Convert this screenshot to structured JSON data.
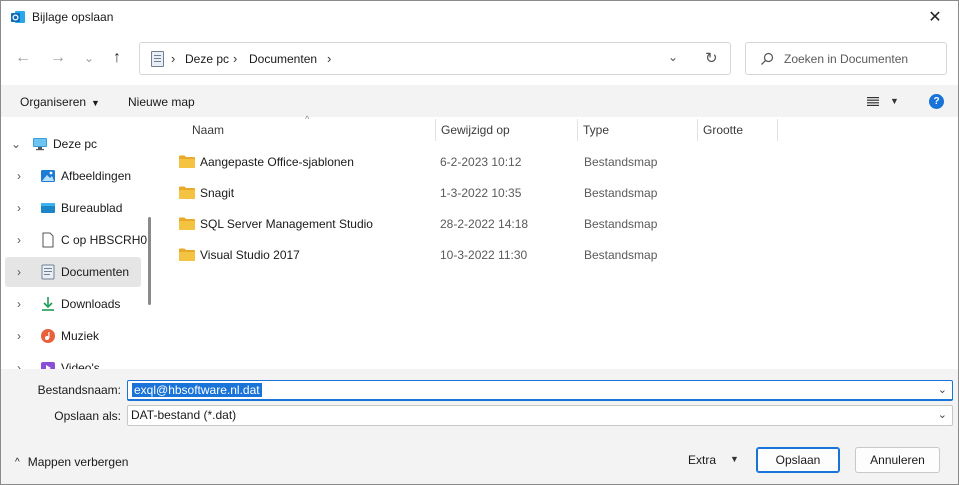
{
  "window": {
    "title": "Bijlage opslaan",
    "close_glyph": "✕"
  },
  "nav": {
    "back_glyph": "←",
    "forward_glyph": "→",
    "recent_glyph": "⌄",
    "up_glyph": "↑",
    "breadcrumb": [
      "Deze pc",
      "Documenten"
    ],
    "sep_glyph": "›",
    "dropdown_glyph": "⌄",
    "refresh_glyph": "↻",
    "search_placeholder": "Zoeken in Documenten"
  },
  "toolbar": {
    "organize_label": "Organiseren",
    "new_folder_label": "Nieuwe map",
    "help_glyph": "?"
  },
  "sidebar": {
    "items": [
      {
        "label": "Deze pc",
        "chevron": "⌄",
        "icon": "monitor-icon"
      },
      {
        "label": "Afbeeldingen",
        "chevron": "›",
        "icon": "pictures-icon"
      },
      {
        "label": "Bureaublad",
        "chevron": "›",
        "icon": "desktop-icon"
      },
      {
        "label": "C op HBSCRH0",
        "chevron": "›",
        "icon": "document-blank-icon"
      },
      {
        "label": "Documenten",
        "chevron": "›",
        "icon": "documents-icon",
        "selected": true
      },
      {
        "label": "Downloads",
        "chevron": "›",
        "icon": "download-icon"
      },
      {
        "label": "Muziek",
        "chevron": "›",
        "icon": "music-icon"
      },
      {
        "label": "Video's",
        "chevron": "›",
        "icon": "videos-icon"
      }
    ]
  },
  "filelist": {
    "columns": [
      "Naam",
      "Gewijzigd op",
      "Type",
      "Grootte"
    ],
    "sort_glyph": "^",
    "rows": [
      {
        "name": "Aangepaste Office-sjablonen",
        "modified": "6-2-2023 10:12",
        "type": "Bestandsmap",
        "size": ""
      },
      {
        "name": "Snagit",
        "modified": "1-3-2022 10:35",
        "type": "Bestandsmap",
        "size": ""
      },
      {
        "name": "SQL Server Management Studio",
        "modified": "28-2-2022 14:18",
        "type": "Bestandsmap",
        "size": ""
      },
      {
        "name": "Visual Studio 2017",
        "modified": "10-3-2022 11:30",
        "type": "Bestandsmap",
        "size": ""
      }
    ]
  },
  "form": {
    "filename_label": "Bestandsnaam:",
    "filename_value": "exql@hbsoftware.nl.dat",
    "savetype_label": "Opslaan als:",
    "savetype_value": "DAT-bestand (*.dat)",
    "caret_glyph": "⌄"
  },
  "footer": {
    "hide_folders_label": "Mappen verbergen",
    "hide_caret": "^",
    "extra_label": "Extra",
    "extra_caret": "▼",
    "save_label": "Opslaan",
    "cancel_label": "Annuleren"
  },
  "colors": {
    "accent": "#1a73d8",
    "folder": "#f5c342",
    "outlook": "#0f6cbd"
  }
}
